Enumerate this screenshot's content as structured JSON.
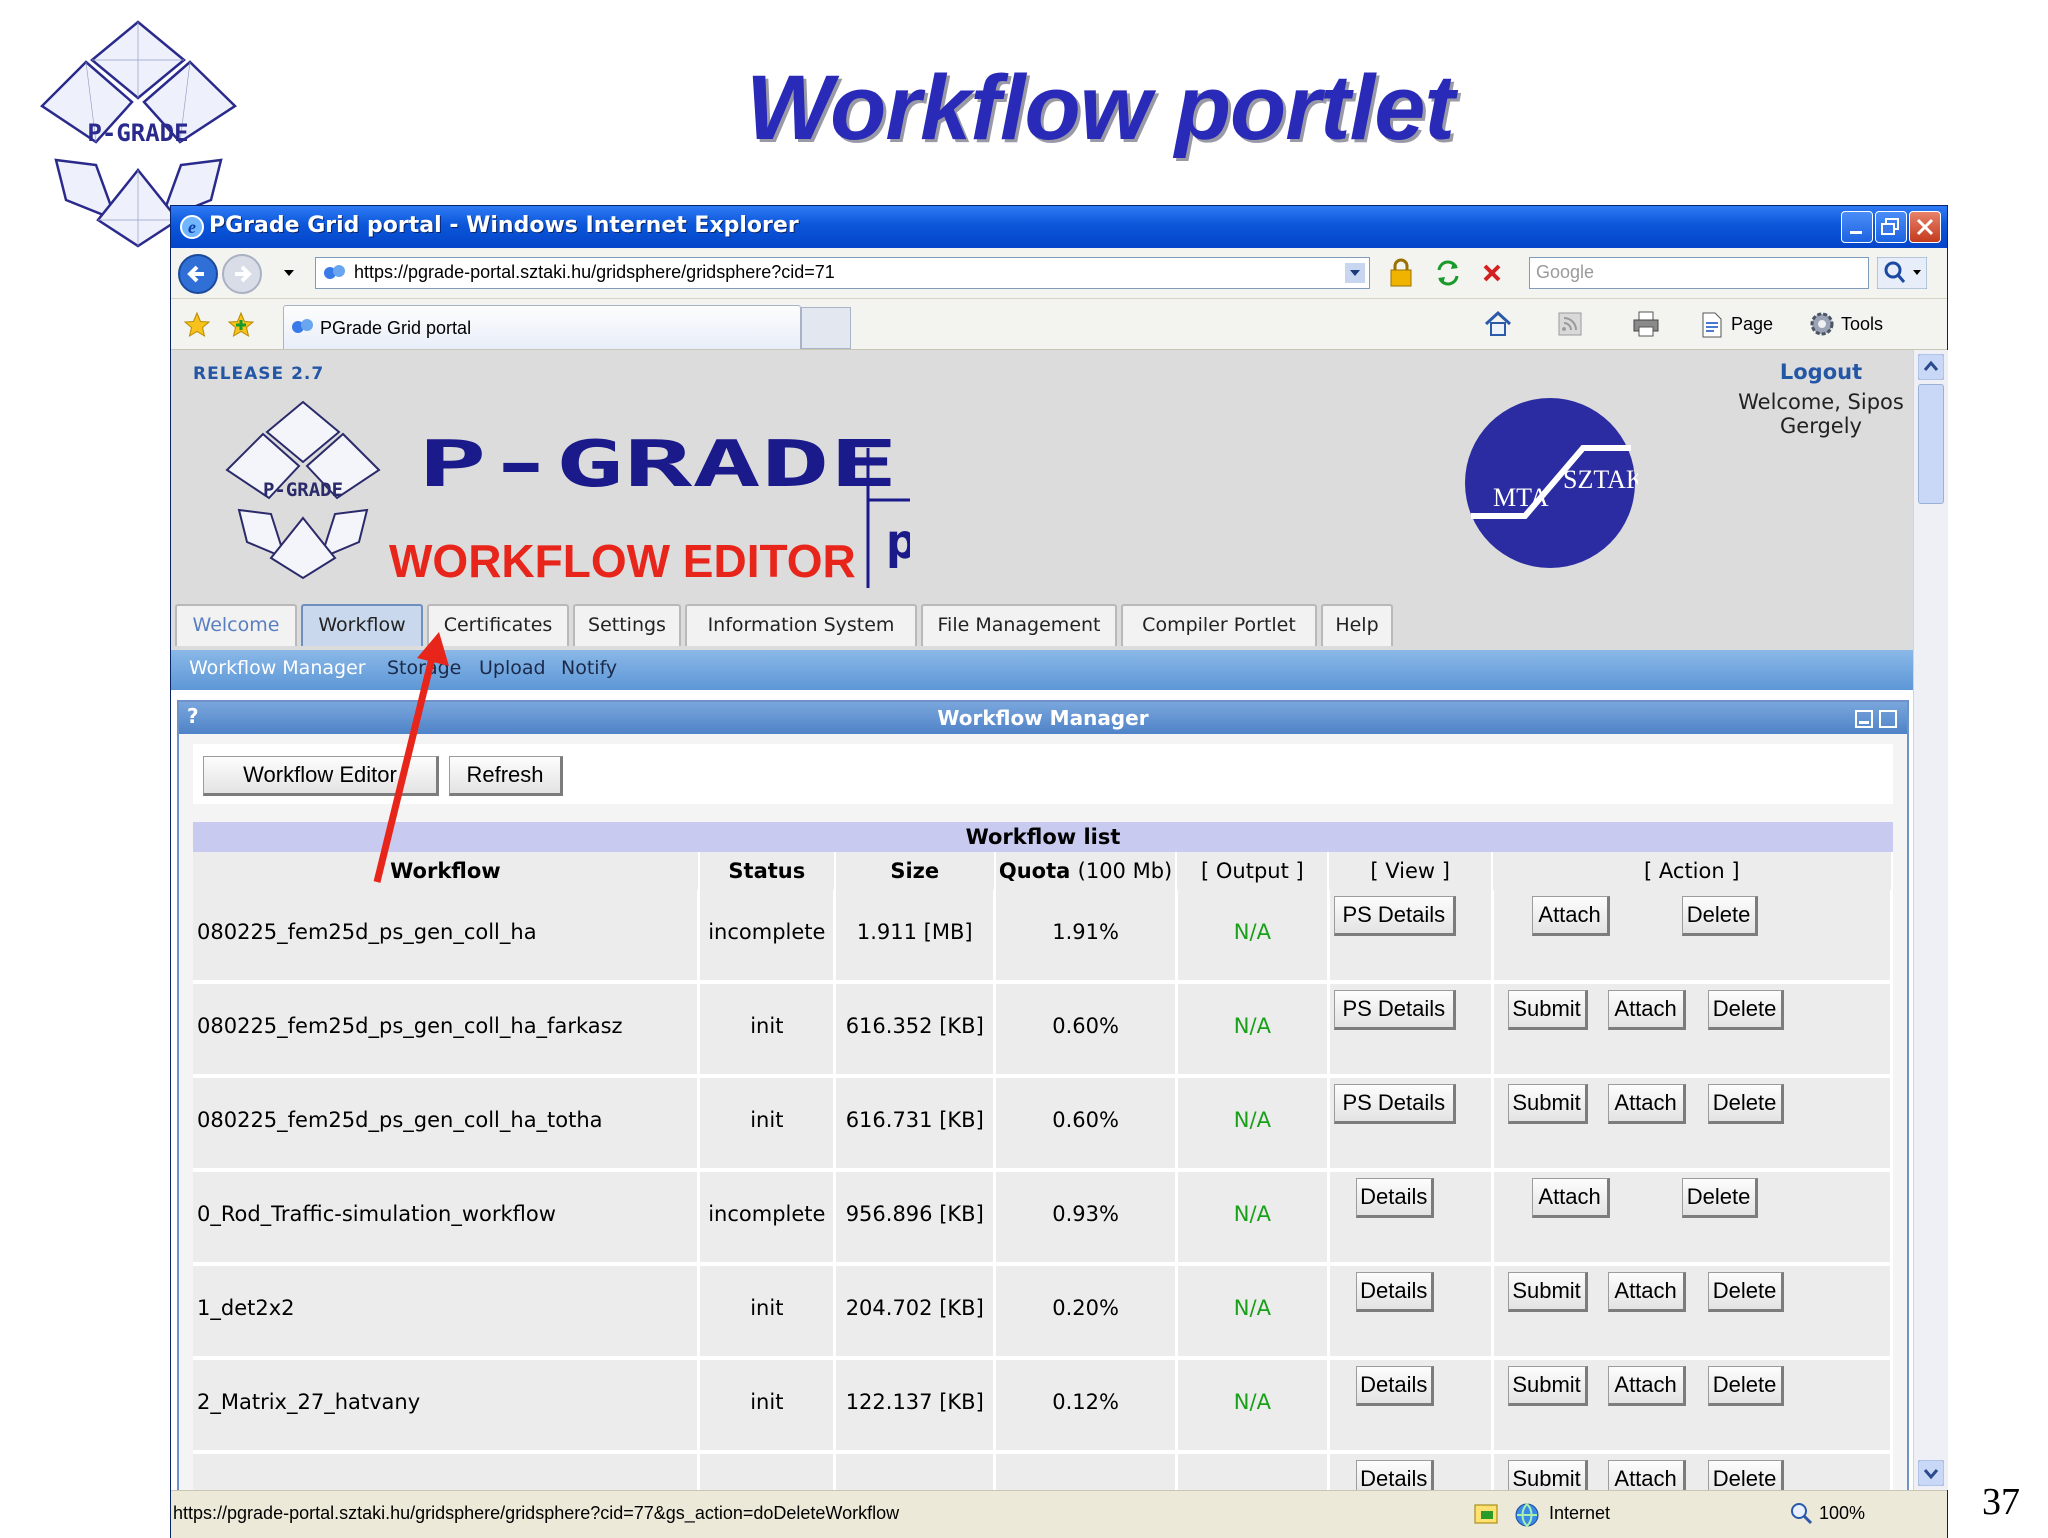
{
  "slide": {
    "title": "Workflow portlet",
    "logo_text": "P-GRADE",
    "page_number": "37"
  },
  "browser": {
    "window_title": "PGrade Grid portal - Windows Internet Explorer",
    "address": "https://pgrade-portal.sztaki.hu/gridsphere/gridsphere?cid=71",
    "search_placeholder": "Google",
    "tab_label": "PGrade Grid portal",
    "commands": {
      "page": "Page",
      "tools": "Tools"
    },
    "status_url": "https://pgrade-portal.sztaki.hu/gridsphere/gridsphere?cid=77&gs_action=doDeleteWorkflow",
    "status_zone": "Internet",
    "zoom": "100%"
  },
  "portal": {
    "release": "RELEASE 2.7",
    "brand": "P-GRADE",
    "brand_sub": "portal",
    "annotation": "WORKFLOW EDITOR",
    "sztaki_left": "MTA",
    "sztaki_right": "SZTAKI",
    "logout": "Logout",
    "welcome_line1": "Welcome, Sipos",
    "welcome_line2": "Gergely",
    "tabs": [
      "Welcome",
      "Workflow",
      "Certificates",
      "Settings",
      "Information System",
      "File Management",
      "Compiler Portlet",
      "Help"
    ],
    "active_tab": "Workflow",
    "subnav": [
      "Workflow Manager",
      "Storage",
      "Upload",
      "Notify"
    ],
    "active_subnav": "Workflow Manager"
  },
  "portlet": {
    "help": "?",
    "title": "Workflow Manager",
    "buttons": {
      "editor": "Workflow Editor",
      "refresh": "Refresh"
    },
    "list_title": "Workflow list",
    "columns": {
      "workflow": "Workflow",
      "status": "Status",
      "size": "Size",
      "quota_bold": "Quota",
      "quota_unit": "(100 Mb)",
      "output": "[ Output ]",
      "view": "[ View ]",
      "action": "[ Action ]"
    },
    "rows": [
      {
        "name": "080225_fem25d_ps_gen_coll_ha",
        "status": "incomplete",
        "size": "1.911 [MB]",
        "quota": "1.91%",
        "output": "N/A",
        "view": "PS Details",
        "actions": [
          "Attach",
          "Delete"
        ]
      },
      {
        "name": "080225_fem25d_ps_gen_coll_ha_farkasz",
        "status": "init",
        "size": "616.352 [KB]",
        "quota": "0.60%",
        "output": "N/A",
        "view": "PS Details",
        "actions": [
          "Submit",
          "Attach",
          "Delete"
        ]
      },
      {
        "name": "080225_fem25d_ps_gen_coll_ha_totha",
        "status": "init",
        "size": "616.731 [KB]",
        "quota": "0.60%",
        "output": "N/A",
        "view": "PS Details",
        "actions": [
          "Submit",
          "Attach",
          "Delete"
        ]
      },
      {
        "name": "0_Rod_Traffic-simulation_workflow",
        "status": "incomplete",
        "size": "956.896 [KB]",
        "quota": "0.93%",
        "output": "N/A",
        "view": "Details",
        "actions": [
          "Attach",
          "Delete"
        ]
      },
      {
        "name": "1_det2x2",
        "status": "init",
        "size": "204.702 [KB]",
        "quota": "0.20%",
        "output": "N/A",
        "view": "Details",
        "actions": [
          "Submit",
          "Attach",
          "Delete"
        ]
      },
      {
        "name": "2_Matrix_27_hatvany",
        "status": "init",
        "size": "122.137 [KB]",
        "quota": "0.12%",
        "output": "N/A",
        "view": "Details",
        "actions": [
          "Submit",
          "Attach",
          "Delete"
        ]
      },
      {
        "name": "",
        "status": "",
        "size": "",
        "quota": "",
        "output": "",
        "view": "Details",
        "actions": [
          "Submit",
          "Attach",
          "Delete"
        ]
      }
    ]
  },
  "colors": {
    "title_blue": "#2a2ab8",
    "annotation_red": "#e8251a",
    "link_blue": "#2456a6",
    "na_green": "#18a018",
    "xp_titlebar": "#0b56d9"
  },
  "icons": [
    "pgrade-logo",
    "ie-icon",
    "back-icon",
    "forward-icon",
    "lock-icon",
    "refresh-icon",
    "stop-icon",
    "search-icon",
    "favorites-star-icon",
    "add-favorite-icon",
    "home-icon",
    "feed-icon",
    "print-icon",
    "page-icon",
    "tools-gear-icon",
    "globe-icon",
    "zoom-icon",
    "red-arrow-icon"
  ]
}
